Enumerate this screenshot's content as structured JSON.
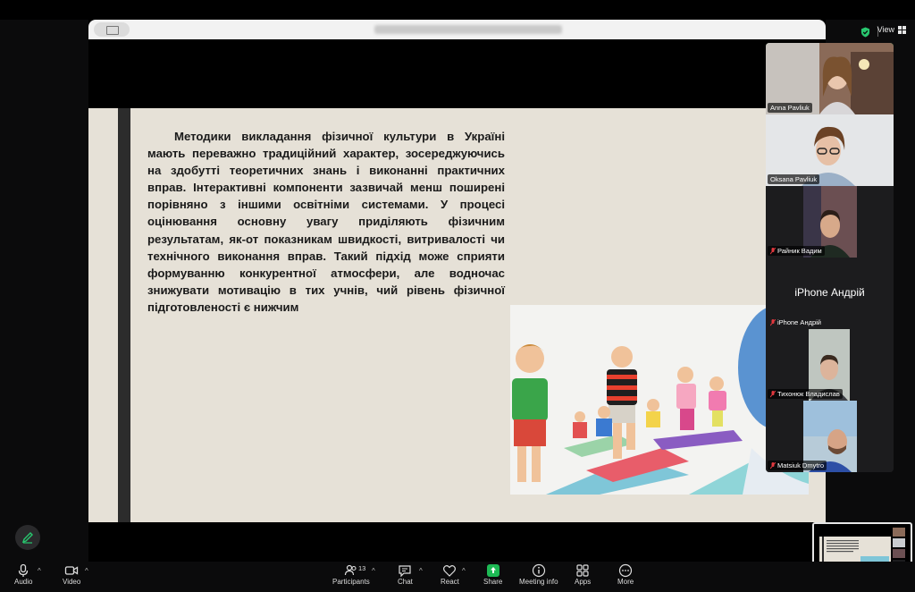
{
  "top_right": {
    "view_label": "View"
  },
  "slide": {
    "paragraph": "Методики викладання фізичної культури в Україні мають переважно традиційний характер, зосереджуючись на здобутті теоретичних знань і виконанні практичних вправ. Інтерактивні компоненти зазвичай менш поширені порівняно з іншими освітніми системами. У процесі оцінювання основну увагу приділяють фізичним результатам, як-от показникам швидкості, витривалості чи технічного виконання вправ. Такий підхід може сприяти формуванню конкурентної атмосфери, але водночас знижувати мотивацію в тих учнів, чий рівень фізичної підготовленості є нижчим"
  },
  "participants": [
    {
      "name": "Anna Pavliuk",
      "muted": false,
      "active": true
    },
    {
      "name": "Oksana Pavliuk",
      "muted": false,
      "active": false
    },
    {
      "name": "Райник Вадим",
      "muted": true,
      "active": false
    },
    {
      "name": "iPhone Андрій",
      "muted": true,
      "active": false,
      "display_name": "iPhone Андрій"
    },
    {
      "name": "Тихонюк Владислав",
      "muted": true,
      "active": false
    },
    {
      "name": "Matsiuk Dmytro",
      "muted": true,
      "active": false
    }
  ],
  "toolbar": {
    "audio": "Audio",
    "video": "Video",
    "participants": "Participants",
    "participants_count": "13",
    "chat": "Chat",
    "react": "React",
    "share": "Share",
    "meeting_info": "Meeting info",
    "apps": "Apps",
    "more": "More"
  },
  "colors": {
    "active_border": "#28c76f",
    "share_green": "#1db954",
    "muted_red": "#e0383e"
  }
}
